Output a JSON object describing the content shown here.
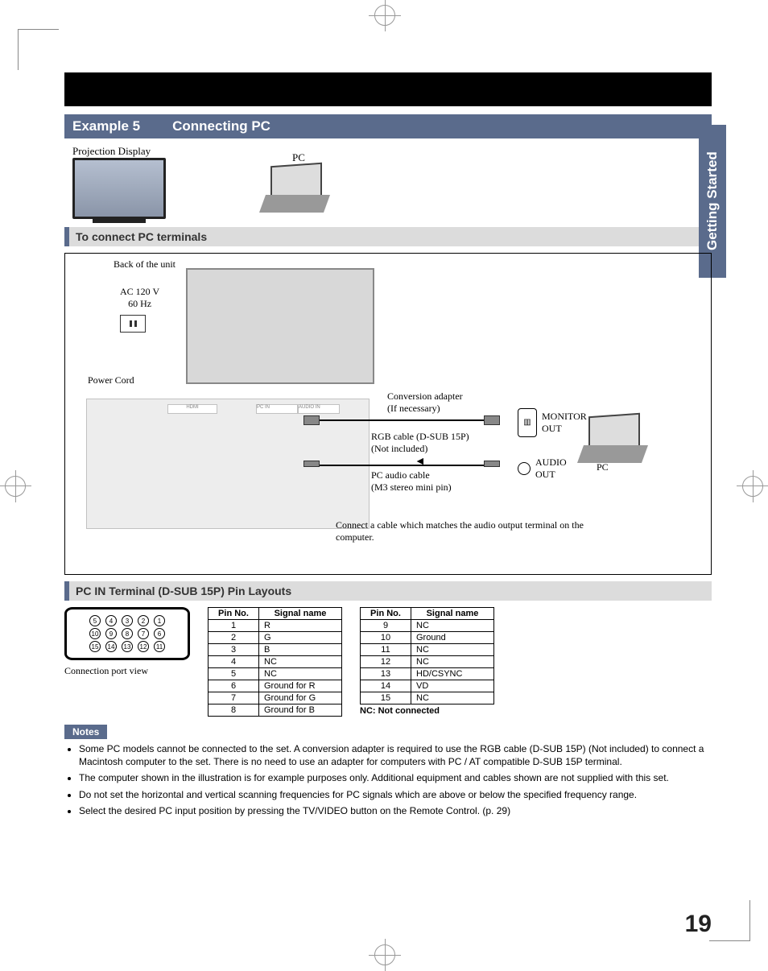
{
  "side_tab": "Getting Started",
  "section": {
    "example_label": "Example 5",
    "title": "Connecting PC"
  },
  "top_labels": {
    "projection_display": "Projection Display",
    "pc": "PC"
  },
  "subsection1": "To connect PC terminals",
  "diagram": {
    "back_of_unit": "Back of the unit",
    "ac_line1": "AC 120 V",
    "ac_line2": "60 Hz",
    "power_cord": "Power Cord",
    "conversion_adapter_l1": "Conversion adapter",
    "conversion_adapter_l2": "(If necessary)",
    "rgb_cable_l1": "RGB cable (D-SUB 15P)",
    "rgb_cable_l2": "(Not included)",
    "pc_audio_l1": "PC audio cable",
    "pc_audio_l2": "(M3 stereo mini pin)",
    "connect_note": "Connect a cable which matches the audio output terminal on the computer.",
    "monitor_out_l1": "MONITOR",
    "monitor_out_l2": "OUT",
    "audio_out_l1": "AUDIO",
    "audio_out_l2": "OUT",
    "pc_label": "PC"
  },
  "subsection2": "PC IN Terminal (D-SUB 15P) Pin Layouts",
  "port_caption": "Connection port view",
  "pin_table": {
    "headers": [
      "Pin No.",
      "Signal name"
    ],
    "left": [
      {
        "no": "1",
        "name": "R"
      },
      {
        "no": "2",
        "name": "G"
      },
      {
        "no": "3",
        "name": "B"
      },
      {
        "no": "4",
        "name": "NC"
      },
      {
        "no": "5",
        "name": "NC"
      },
      {
        "no": "6",
        "name": "Ground for R"
      },
      {
        "no": "7",
        "name": "Ground for G"
      },
      {
        "no": "8",
        "name": "Ground for B"
      }
    ],
    "right": [
      {
        "no": "9",
        "name": "NC"
      },
      {
        "no": "10",
        "name": "Ground"
      },
      {
        "no": "11",
        "name": "NC"
      },
      {
        "no": "12",
        "name": "NC"
      },
      {
        "no": "13",
        "name": "HD/CSYNC"
      },
      {
        "no": "14",
        "name": "VD"
      },
      {
        "no": "15",
        "name": "NC"
      }
    ],
    "nc_note": "NC: Not connected"
  },
  "dsub_pins": {
    "row1": [
      "5",
      "4",
      "3",
      "2",
      "1"
    ],
    "row2": [
      "10",
      "9",
      "8",
      "7",
      "6"
    ],
    "row3": [
      "15",
      "14",
      "13",
      "12",
      "11"
    ]
  },
  "notes_label": "Notes",
  "notes": [
    "Some PC models cannot be connected to the set. A conversion adapter is required to use the RGB cable (D-SUB 15P) (Not included) to connect a Macintosh computer to the set. There is no need to use an adapter for computers with PC / AT compatible D-SUB 15P terminal.",
    "The computer shown in the illustration is for example purposes only. Additional equipment and cables shown are not supplied with this set.",
    "Do not set the horizontal and vertical scanning frequencies for PC signals which are above or below the specified frequency range.",
    "Select the desired PC input position by pressing the TV/VIDEO button on the Remote Control. (p. 29)"
  ],
  "page_number": "19"
}
